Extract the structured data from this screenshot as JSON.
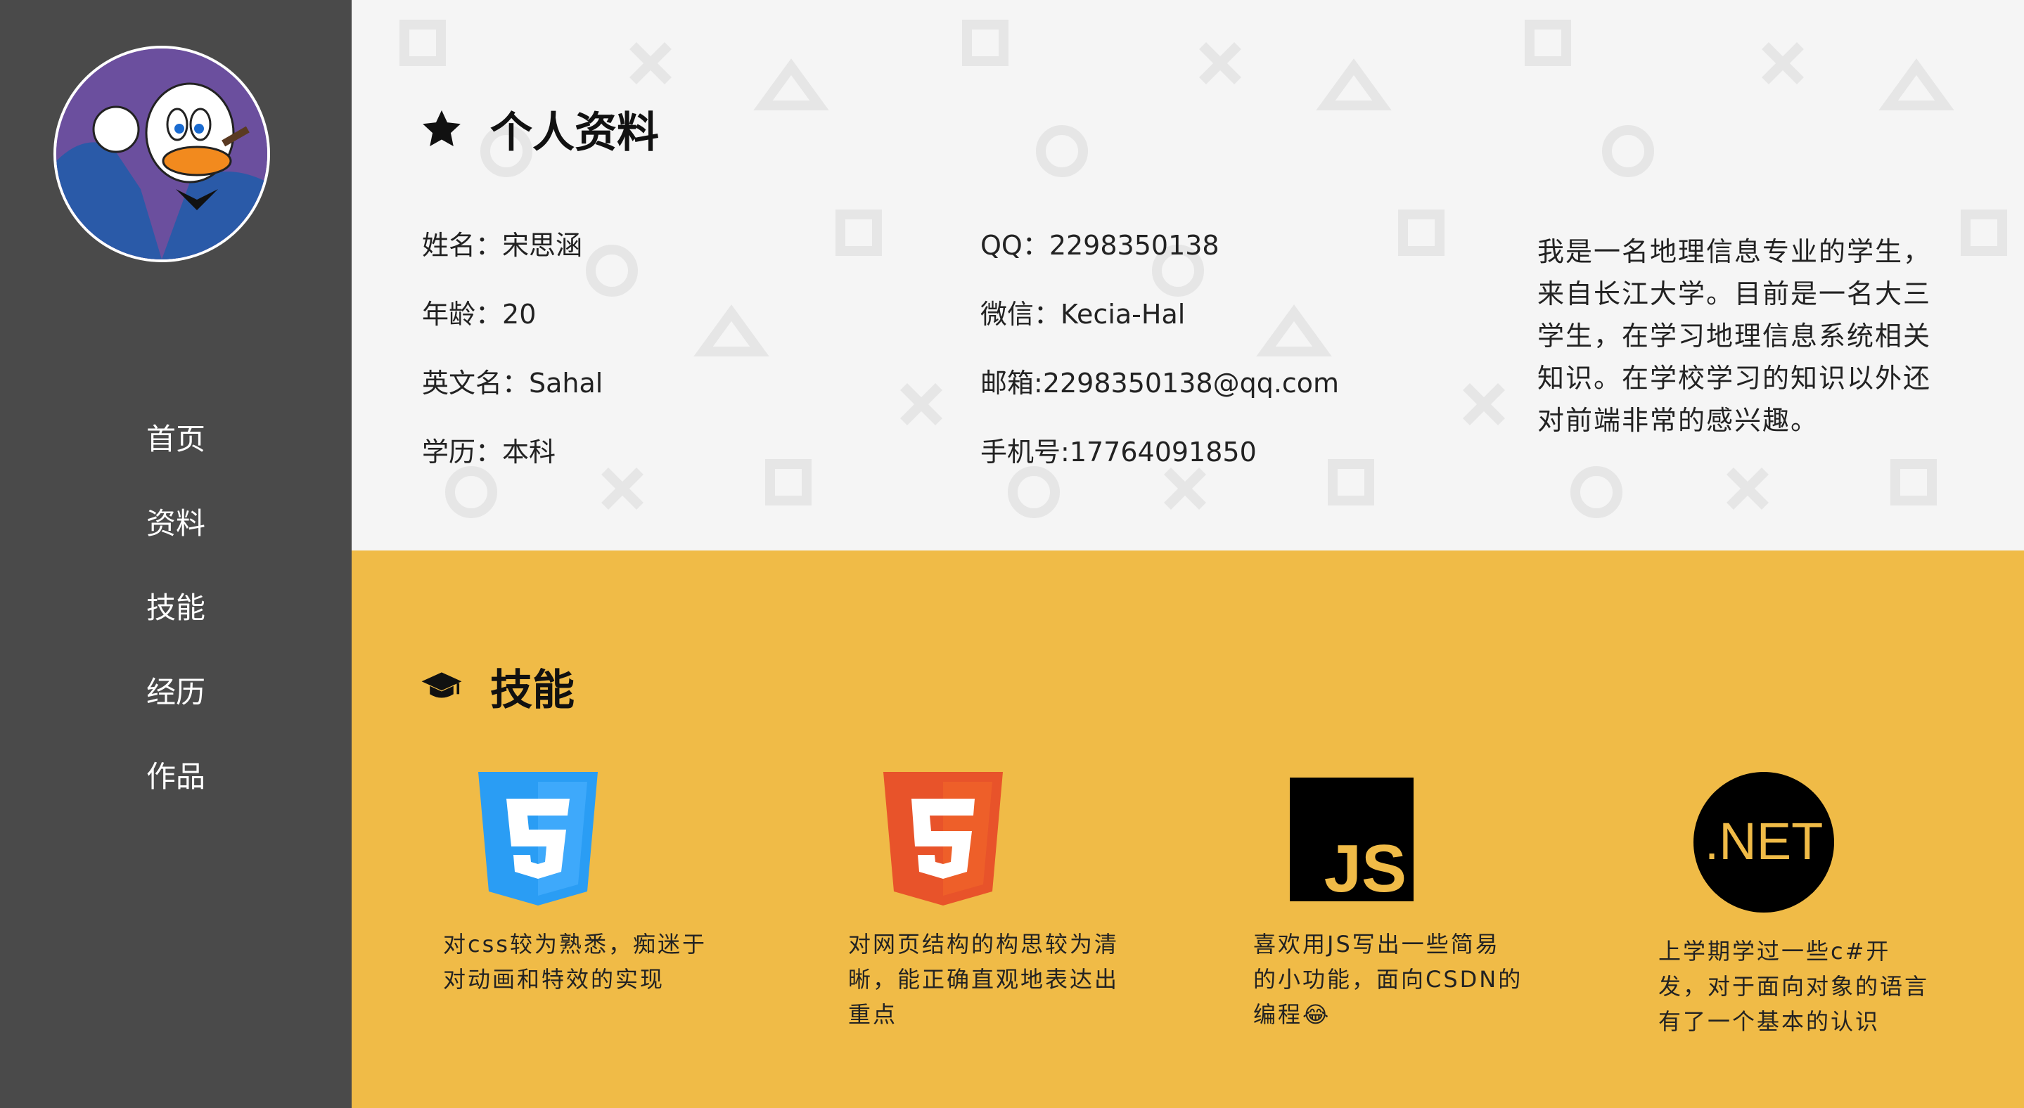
{
  "sidebar": {
    "avatar_alt": "avatar",
    "nav": [
      "首页",
      "资料",
      "技能",
      "经历",
      "作品"
    ]
  },
  "profile": {
    "title": "个人资料",
    "title_icon": "star-icon",
    "col1": [
      {
        "label": "姓名：",
        "value": "宋思涵"
      },
      {
        "label": "年龄：",
        "value": "20"
      },
      {
        "label": "英文名：",
        "value": "Sahal"
      },
      {
        "label": "学历：",
        "value": "本科"
      }
    ],
    "col2": [
      {
        "label": "QQ：",
        "value": "2298350138"
      },
      {
        "label": "微信：",
        "value": "Kecia-Hal"
      },
      {
        "label": "邮箱:",
        "value": "2298350138@qq.com"
      },
      {
        "label": "手机号:",
        "value": "17764091850"
      }
    ],
    "bio_lines": [
      "我是一名地理信息专业的学生，",
      "来自长江大学。目前是一名大三",
      "学生，在学习地理信息系统相关",
      "知识。在学校学习的知识以外还",
      "对前端非常的感兴趣。"
    ]
  },
  "skills": {
    "title": "技能",
    "title_icon": "graduation-cap-icon",
    "items": [
      {
        "logo": "css3-logo-icon",
        "color": "#2a9df4",
        "desc": [
          "对css较为熟悉，痴迷于",
          "对动画和特效的实现"
        ]
      },
      {
        "logo": "html5-logo-icon",
        "color": "#e8532a",
        "desc": [
          "对网页结构的构思较为清",
          "晰，能正确直观地表达出",
          "重点"
        ]
      },
      {
        "logo": "js-logo-icon",
        "color": "#000000",
        "logo_text": "JS",
        "desc": [
          "喜欢用JS写出一些简易",
          "的小功能，面向CSDN的",
          "编程😂"
        ]
      },
      {
        "logo": "dotnet-logo-icon",
        "color": "#000000",
        "logo_text": ".NET",
        "desc": [
          "上学期学过一些c#开",
          "发，对于面向对象的语言",
          "有了一个基本的认识"
        ]
      }
    ]
  },
  "colors": {
    "sidebar": "#4a4a4a",
    "profile_bg": "#f5f5f5",
    "skills_bg": "#f0bb47",
    "accent_logo_text": "#f0bb47"
  }
}
